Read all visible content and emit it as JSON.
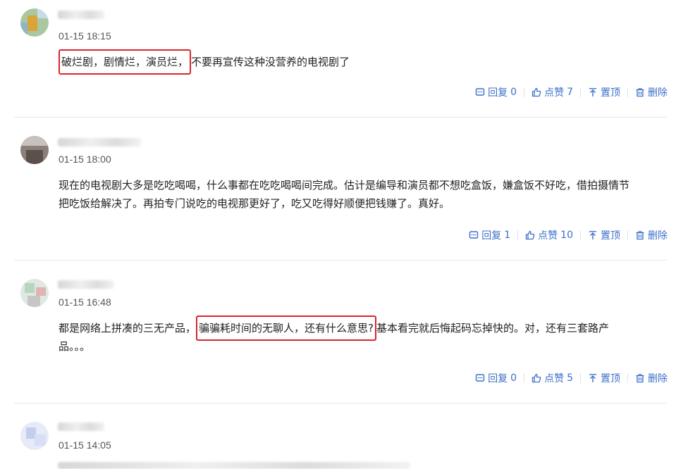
{
  "labels": {
    "reply": "回复",
    "like": "点赞",
    "pin": "置顶",
    "delete": "删除"
  },
  "comments": [
    {
      "time": "01-15 18:15",
      "highlight": "破烂剧，剧情烂，演员烂，",
      "text": "不要再宣传这种没营养的电视剧了",
      "replies": "0",
      "likes": "7"
    },
    {
      "time": "01-15 18:00",
      "text_line1": "现在的电视剧大多是吃吃喝喝，什么事都在吃吃喝喝间完成。估计是编导和演员都不想吃盒饭，嫌盒饭不好吃，借拍摄情节",
      "text_line2": "把吃饭给解决了。再拍专门说吃的电视那更好了，吃又吃得好顺便把钱赚了。真好。",
      "replies": "1",
      "likes": "10"
    },
    {
      "time": "01-15 16:48",
      "text_pre": "都是网络上拼凑的三无产品，",
      "highlight": "骗骗耗时间的无聊人，还有什么意思?",
      "text_post": "基本看完就后悔起码忘掉快的。对，还有三套路产",
      "text_line2": "品。。。",
      "replies": "0",
      "likes": "5"
    },
    {
      "time": "01-15 14:05"
    }
  ]
}
